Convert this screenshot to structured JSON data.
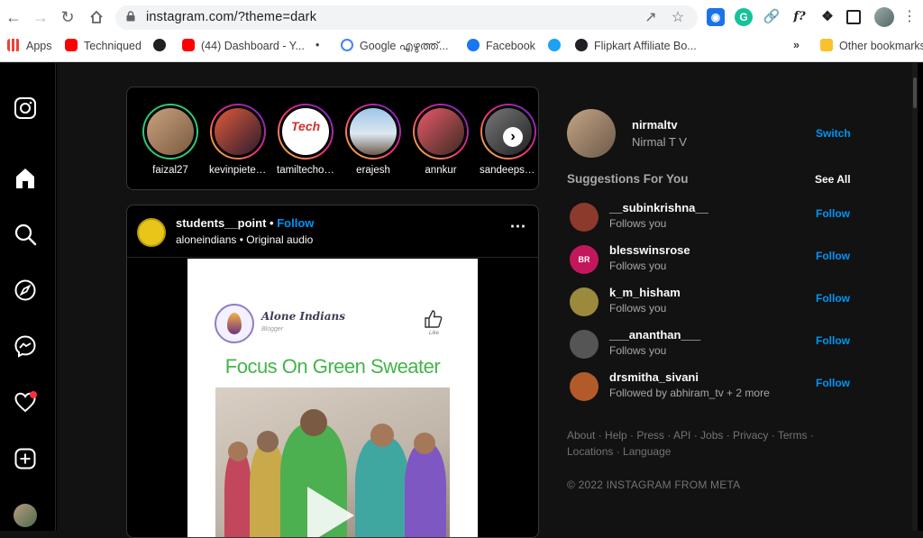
{
  "browser": {
    "url": "instagram.com/?theme=dark",
    "bookmarks": [
      {
        "label": "Apps",
        "color": "#ea4335"
      },
      {
        "label": "Techniqued",
        "color": "#ff0000"
      },
      {
        "label": "",
        "color": "#202124"
      },
      {
        "label": "(44) Dashboard - Y...",
        "color": "#ff0000"
      },
      {
        "label": "•",
        "color": "#202124"
      },
      {
        "label": "Google എഴുത്ത്...",
        "color": "#4285f4"
      },
      {
        "label": "Facebook",
        "color": "#1877f2"
      },
      {
        "label": "",
        "color": "#1da1f2"
      },
      {
        "label": "Flipkart Affiliate Bo...",
        "color": "#202124"
      }
    ],
    "more_bookmarks": "»",
    "other_bookmarks": "Other bookmarks"
  },
  "stories": [
    {
      "name": "faizal27",
      "seen": true
    },
    {
      "name": "kevinpieter...",
      "seen": false
    },
    {
      "name": "tamiltechof...",
      "seen": false
    },
    {
      "name": "erajesh",
      "seen": false
    },
    {
      "name": "annkur",
      "seen": false
    },
    {
      "name": "sandeepsa...",
      "seen": false
    }
  ],
  "post": {
    "username": "students__point",
    "dot": "•",
    "follow": "Follow",
    "subtitle": "aloneindians • Original audio",
    "blog_title": "Alone Indians",
    "blog_sub": "Blogger",
    "like_label": "Like",
    "headline": "Focus On Green Sweater"
  },
  "profile": {
    "username": "nirmaltv",
    "full_name": "Nirmal T V",
    "switch": "Switch"
  },
  "suggestions": {
    "title": "Suggestions For You",
    "see_all": "See All",
    "follow_label": "Follow",
    "items": [
      {
        "name": "__subinkrishna__",
        "reason": "Follows you",
        "color": "#8b3a2b"
      },
      {
        "name": "blesswinsrose",
        "reason": "Follows you",
        "color": "#c2185b"
      },
      {
        "name": "k_m_hisham",
        "reason": "Follows you",
        "color": "#9b8a3c"
      },
      {
        "name": "___ananthan___",
        "reason": "Follows you",
        "color": "#555555"
      },
      {
        "name": "drsmitha_sivani",
        "reason": "Followed by abhiram_tv + 2 more",
        "color": "#b35a2a"
      }
    ]
  },
  "footer": {
    "links": "About · Help · Press · API · Jobs · Privacy · Terms · Locations · Language",
    "copyright": "© 2022 INSTAGRAM FROM META"
  },
  "colors": {
    "accent": "#0095f6",
    "background": "#000000",
    "headline": "#43b549"
  }
}
